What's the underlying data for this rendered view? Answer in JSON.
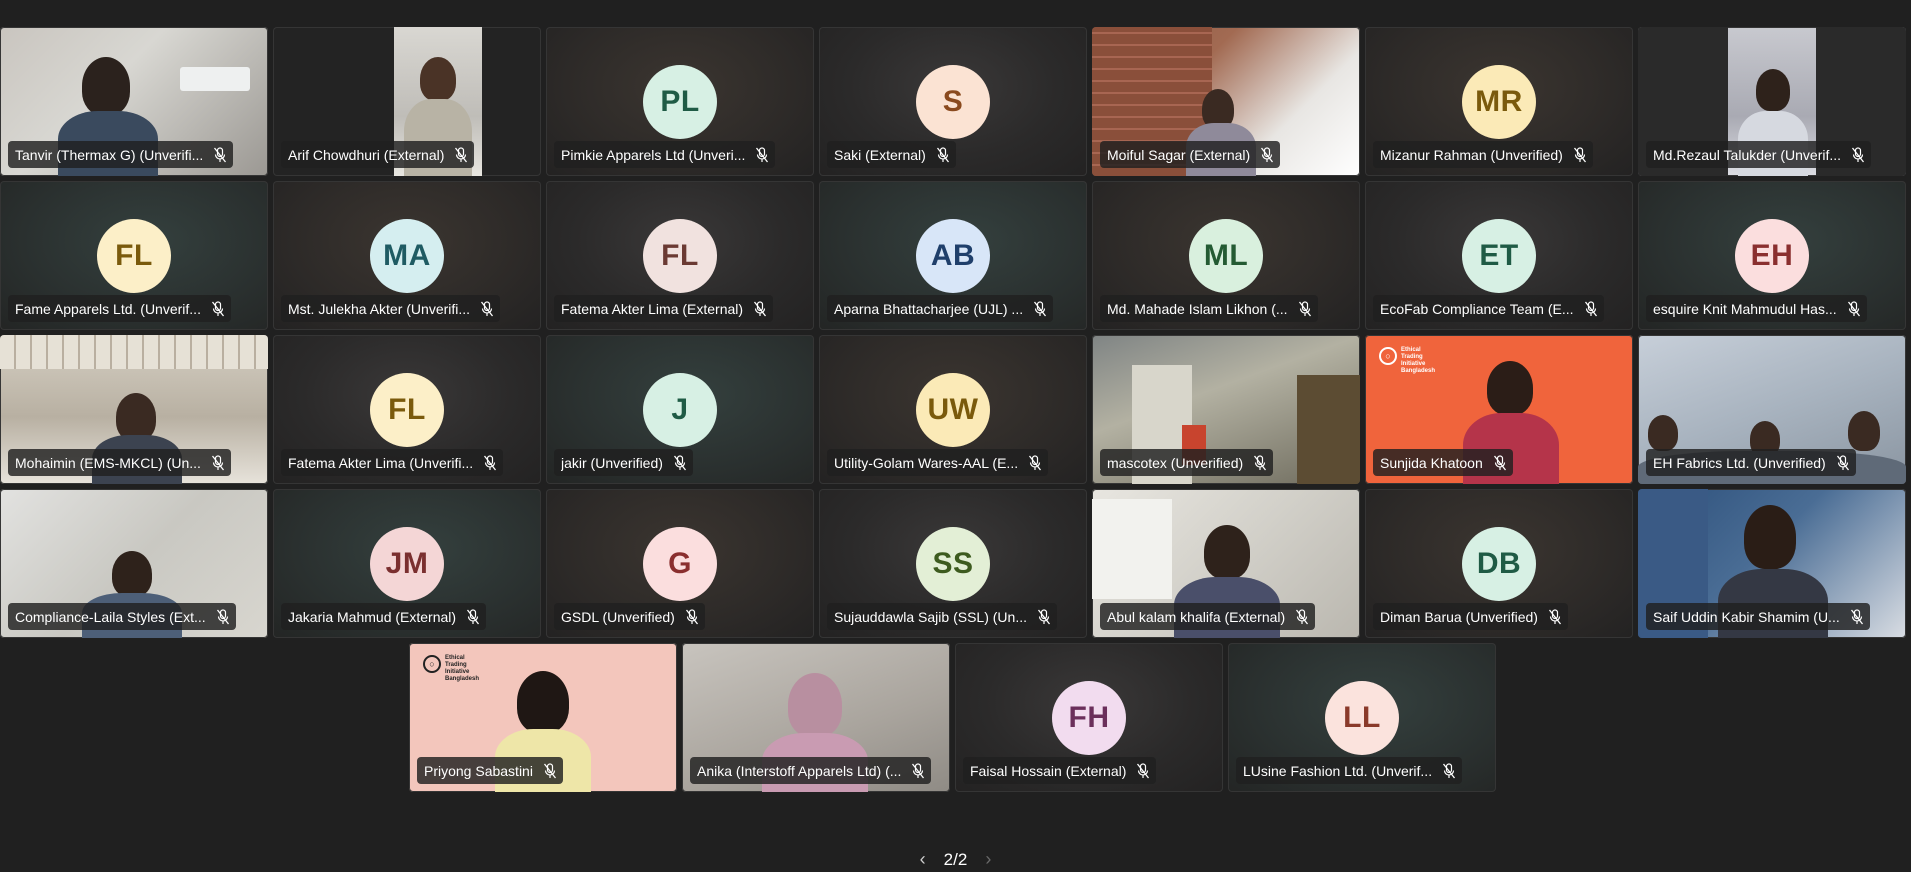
{
  "participants_rows": [
    [
      {
        "name": "Tanvir (Thermax G) (Unverifi...",
        "type": "video",
        "scene": "office"
      },
      {
        "name": "Arif Chowdhuri (External)",
        "type": "video",
        "scene": "portrait"
      },
      {
        "name": "Pimkie Apparels Ltd (Unveri...",
        "type": "avatar",
        "initials": "PL",
        "bg": "#d7f0e4",
        "fg": "#1f5b45"
      },
      {
        "name": "Saki (External)",
        "type": "avatar",
        "initials": "S",
        "bg": "#fbe3d3",
        "fg": "#8a4a1e"
      },
      {
        "name": "Moiful Sagar (External)",
        "type": "video",
        "scene": "brick"
      },
      {
        "name": "Mizanur Rahman (Unverified)",
        "type": "avatar",
        "initials": "MR",
        "bg": "#fbeab7",
        "fg": "#7a5a0c"
      },
      {
        "name": "Md.Rezaul Talukder (Unverif...",
        "type": "video",
        "scene": "cctv"
      }
    ],
    [
      {
        "name": "Fame Apparels Ltd. (Unverif...",
        "type": "avatar",
        "initials": "FL",
        "bg": "#fcefc8",
        "fg": "#7a5a0c"
      },
      {
        "name": "Mst. Julekha Akter (Unverifi...",
        "type": "avatar",
        "initials": "MA",
        "bg": "#d5eef0",
        "fg": "#1f5b63"
      },
      {
        "name": "Fatema Akter Lima (External)",
        "type": "avatar",
        "initials": "FL",
        "bg": "#f1e2df",
        "fg": "#6b3a33"
      },
      {
        "name": "Aparna Bhattacharjee (UJL) ...",
        "type": "avatar",
        "initials": "AB",
        "bg": "#d8e6f8",
        "fg": "#1f3f6b"
      },
      {
        "name": "Md. Mahade Islam Likhon (...",
        "type": "avatar",
        "initials": "ML",
        "bg": "#d9f0de",
        "fg": "#245b33"
      },
      {
        "name": "EcoFab Compliance Team (E...",
        "type": "avatar",
        "initials": "ET",
        "bg": "#d7f0e4",
        "fg": "#1f5b45"
      },
      {
        "name": "esquire Knit Mahmudul Has...",
        "type": "avatar",
        "initials": "EH",
        "bg": "#fbdede",
        "fg": "#8a2f2f"
      }
    ],
    [
      {
        "name": "Mohaimin (EMS-MKCL) (Un...",
        "type": "video",
        "scene": "room"
      },
      {
        "name": "Fatema Akter Lima (Unverifi...",
        "type": "avatar",
        "initials": "FL",
        "bg": "#fcefc8",
        "fg": "#7a5a0c"
      },
      {
        "name": "jakir (Unverified)",
        "type": "avatar",
        "initials": "J",
        "bg": "#d7f0e4",
        "fg": "#1f5b45"
      },
      {
        "name": "Utility-Golam Wares-AAL (E...",
        "type": "avatar",
        "initials": "UW",
        "bg": "#fbeab7",
        "fg": "#7a5a0c"
      },
      {
        "name": "mascotex (Unverified)",
        "type": "video",
        "scene": "hall"
      },
      {
        "name": "Sunjida Khatoon",
        "type": "video",
        "scene": "orange",
        "logo": {
          "line1": "Ethical",
          "line2": "Trading",
          "line3": "Initiative",
          "line4": "Bangladesh"
        }
      },
      {
        "name": "EH Fabrics Ltd. (Unverified)",
        "type": "video",
        "scene": "blueroom"
      }
    ],
    [
      {
        "name": "Compliance-Laila Styles (Ext...",
        "type": "video",
        "scene": "office2"
      },
      {
        "name": "Jakaria Mahmud (External)",
        "type": "avatar",
        "initials": "JM",
        "bg": "#f4d6d6",
        "fg": "#7a2f2f"
      },
      {
        "name": "GSDL (Unverified)",
        "type": "avatar",
        "initials": "G",
        "bg": "#fbdede",
        "fg": "#8a2f2f"
      },
      {
        "name": "Sujauddawla Sajib (SSL) (Un...",
        "type": "avatar",
        "initials": "SS",
        "bg": "#e3efd6",
        "fg": "#3d5b1f"
      },
      {
        "name": "Abul kalam khalifa (External)",
        "type": "video",
        "scene": "white"
      },
      {
        "name": "Diman Barua (Unverified)",
        "type": "avatar",
        "initials": "DB",
        "bg": "#d7f0e4",
        "fg": "#1f5b45"
      },
      {
        "name": "Saif Uddin Kabir Shamim (U...",
        "type": "video",
        "scene": "blue2"
      }
    ],
    [
      {
        "name": "Priyong Sabastini",
        "type": "video",
        "scene": "pink",
        "logo": {
          "line1": "Ethical",
          "line2": "Trading",
          "line3": "Initiative",
          "line4": "Bangladesh"
        }
      },
      {
        "name": "Anika (Interstoff Apparels Ltd) (...",
        "type": "video",
        "scene": "grey"
      },
      {
        "name": "Faisal Hossain (External)",
        "type": "avatar",
        "initials": "FH",
        "bg": "#f2dcef",
        "fg": "#6b2f5b"
      },
      {
        "name": "LUsine Fashion Ltd. (Unverif...",
        "type": "avatar",
        "initials": "LL",
        "bg": "#fbe3dd",
        "fg": "#8a3a2a"
      }
    ]
  ],
  "pager": {
    "label": "2/2",
    "prev_icon": "chevron-left-icon",
    "next_icon": "chevron-right-icon"
  },
  "icons": {
    "mic_muted": "mic-off-icon"
  }
}
